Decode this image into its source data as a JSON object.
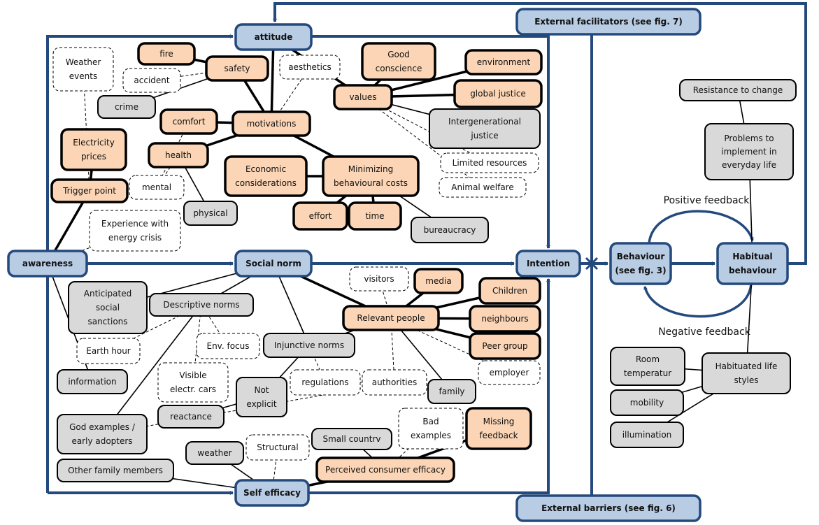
{
  "colors": {
    "blue_fill": "#b8cce4",
    "blue_stroke": "#24497d",
    "orange_fill": "#fbd5b5",
    "grey_fill": "#d9d9d9",
    "dashed_fill": "#ffffff",
    "line": "#000000"
  },
  "feedback": {
    "positive": "Positive feedback",
    "negative": "Negative feedback"
  },
  "nodes": [
    {
      "id": "attitude",
      "type": "blue",
      "lines": [
        "attitude"
      ]
    },
    {
      "id": "social_norm",
      "type": "blue",
      "lines": [
        "Social norm"
      ]
    },
    {
      "id": "awareness",
      "type": "blue",
      "lines": [
        "awareness"
      ]
    },
    {
      "id": "self_efficacy",
      "type": "blue",
      "lines": [
        "Self efficacy"
      ]
    },
    {
      "id": "intention",
      "type": "blue",
      "lines": [
        "Intention"
      ]
    },
    {
      "id": "ext_fac",
      "type": "blue",
      "lines": [
        "External facilitators (see fig. 7)"
      ]
    },
    {
      "id": "ext_bar",
      "type": "blue",
      "lines": [
        "External barriers (see fig. 6)"
      ]
    },
    {
      "id": "behaviour",
      "type": "blue",
      "lines": [
        "Behaviour",
        "(see fig. 3)"
      ]
    },
    {
      "id": "habitual",
      "type": "blue",
      "lines": [
        "Habitual",
        "behaviour"
      ]
    },
    {
      "id": "fire",
      "type": "orange",
      "lines": [
        "fire"
      ]
    },
    {
      "id": "safety",
      "type": "orange",
      "lines": [
        "safety"
      ]
    },
    {
      "id": "comfort",
      "type": "orange",
      "lines": [
        "comfort"
      ]
    },
    {
      "id": "motivations",
      "type": "orange",
      "lines": [
        "motivations"
      ]
    },
    {
      "id": "electricity",
      "type": "orange",
      "lines": [
        "Electricity",
        "prices"
      ]
    },
    {
      "id": "trigger",
      "type": "orange",
      "lines": [
        "Trigger point"
      ]
    },
    {
      "id": "health",
      "type": "orange",
      "lines": [
        "health"
      ]
    },
    {
      "id": "economic",
      "type": "orange",
      "lines": [
        "Economic",
        "considerations"
      ]
    },
    {
      "id": "minimizing",
      "type": "orange",
      "lines": [
        "Minimizing",
        "behavioural  costs"
      ]
    },
    {
      "id": "effort",
      "type": "orange",
      "lines": [
        "effort"
      ]
    },
    {
      "id": "time",
      "type": "orange",
      "lines": [
        "time"
      ]
    },
    {
      "id": "good_conscience",
      "type": "orange",
      "lines": [
        "Good",
        "conscience"
      ]
    },
    {
      "id": "values",
      "type": "orange",
      "lines": [
        "values"
      ]
    },
    {
      "id": "environment",
      "type": "orange",
      "lines": [
        "environment"
      ]
    },
    {
      "id": "global_justice",
      "type": "orange",
      "lines": [
        "global justice"
      ]
    },
    {
      "id": "media",
      "type": "orange",
      "lines": [
        "media"
      ]
    },
    {
      "id": "children",
      "type": "orange",
      "lines": [
        "Children"
      ]
    },
    {
      "id": "relevant",
      "type": "orange",
      "lines": [
        "Relevant people"
      ]
    },
    {
      "id": "neighbours",
      "type": "orange",
      "lines": [
        "neighbours"
      ]
    },
    {
      "id": "peer",
      "type": "orange",
      "lines": [
        "Peer group"
      ]
    },
    {
      "id": "perceived",
      "type": "orange",
      "lines": [
        "Perceived  consumer  efficacy"
      ]
    },
    {
      "id": "missing",
      "type": "orange",
      "lines": [
        "Missing",
        "feedback"
      ]
    },
    {
      "id": "crime",
      "type": "grey",
      "lines": [
        "crime"
      ]
    },
    {
      "id": "physical",
      "type": "grey",
      "lines": [
        "physical"
      ]
    },
    {
      "id": "intergen",
      "type": "grey",
      "lines": [
        "Intergenerational",
        "justice"
      ]
    },
    {
      "id": "bureaucracy",
      "type": "grey",
      "lines": [
        "bureaucracy"
      ]
    },
    {
      "id": "resistance",
      "type": "grey",
      "lines": [
        "Resistance to change"
      ]
    },
    {
      "id": "problems",
      "type": "grey",
      "lines": [
        "Problems  to",
        "implement  in",
        "everyday  life"
      ]
    },
    {
      "id": "anticipated",
      "type": "grey",
      "lines": [
        "Anticipated",
        "social",
        "sanctions"
      ]
    },
    {
      "id": "descriptive",
      "type": "grey",
      "lines": [
        "Descriptive  norms"
      ]
    },
    {
      "id": "injunctive",
      "type": "grey",
      "lines": [
        "Injunctive  norms"
      ]
    },
    {
      "id": "information",
      "type": "grey",
      "lines": [
        "information"
      ]
    },
    {
      "id": "not_explicit",
      "type": "grey",
      "lines": [
        "Not",
        "explicit"
      ]
    },
    {
      "id": "reactance",
      "type": "grey",
      "lines": [
        "reactance"
      ]
    },
    {
      "id": "god_examples",
      "type": "grey",
      "lines": [
        "God examples  /",
        "early adopters"
      ]
    },
    {
      "id": "other_family",
      "type": "grey",
      "lines": [
        "Other family  members"
      ]
    },
    {
      "id": "weather",
      "type": "grey",
      "lines": [
        "weather"
      ]
    },
    {
      "id": "small_country",
      "type": "grey",
      "lines": [
        "Small  countrv"
      ]
    },
    {
      "id": "family",
      "type": "grey",
      "lines": [
        "family"
      ]
    },
    {
      "id": "habituated",
      "type": "grey",
      "lines": [
        "Habituated  life",
        "styles"
      ]
    },
    {
      "id": "room",
      "type": "grey",
      "lines": [
        "Room",
        "temperatur"
      ]
    },
    {
      "id": "mobility",
      "type": "grey",
      "lines": [
        "mobility"
      ]
    },
    {
      "id": "illumination",
      "type": "grey",
      "lines": [
        "illumination"
      ]
    },
    {
      "id": "weather_events",
      "type": "dashed",
      "lines": [
        "Weather",
        "events"
      ]
    },
    {
      "id": "accident",
      "type": "dashed",
      "lines": [
        "accident"
      ]
    },
    {
      "id": "aesthetics",
      "type": "dashed",
      "lines": [
        "aesthetics"
      ]
    },
    {
      "id": "mental",
      "type": "dashed",
      "lines": [
        "mental"
      ]
    },
    {
      "id": "experience",
      "type": "dashed",
      "lines": [
        "Experience  with",
        "energy crisis"
      ]
    },
    {
      "id": "limited",
      "type": "dashed",
      "lines": [
        "Limited  resources"
      ]
    },
    {
      "id": "animal",
      "type": "dashed",
      "lines": [
        "Animal  welfare"
      ]
    },
    {
      "id": "visitors",
      "type": "dashed",
      "lines": [
        "visitors"
      ]
    },
    {
      "id": "earth_hour",
      "type": "dashed",
      "lines": [
        "Earth hour"
      ]
    },
    {
      "id": "env_focus",
      "type": "dashed",
      "lines": [
        "Env.  focus"
      ]
    },
    {
      "id": "visible",
      "type": "dashed",
      "lines": [
        "Visible",
        "electr. cars"
      ]
    },
    {
      "id": "regulations",
      "type": "dashed",
      "lines": [
        "regulations"
      ]
    },
    {
      "id": "authorities",
      "type": "dashed",
      "lines": [
        "authorities"
      ]
    },
    {
      "id": "employer",
      "type": "dashed",
      "lines": [
        "employer"
      ]
    },
    {
      "id": "structural",
      "type": "dashed",
      "lines": [
        "Structural"
      ]
    },
    {
      "id": "bad_examples",
      "type": "dashed",
      "lines": [
        "Bad",
        "examples"
      ]
    }
  ],
  "edges": [
    [
      "attitude",
      "motivations",
      "thick"
    ],
    [
      "attitude",
      "values",
      "thick"
    ],
    [
      "fire",
      "safety",
      "thick"
    ],
    [
      "safety",
      "motivations",
      "thick"
    ],
    [
      "comfort",
      "motivations",
      "thick"
    ],
    [
      "health",
      "motivations",
      "thick"
    ],
    [
      "motivations",
      "minimizing",
      "thick"
    ],
    [
      "economic",
      "minimizing",
      "thick"
    ],
    [
      "minimizing",
      "effort",
      "thick"
    ],
    [
      "minimizing",
      "time",
      "thick"
    ],
    [
      "electricity",
      "trigger",
      "thick"
    ],
    [
      "trigger",
      "awareness",
      "thick"
    ],
    [
      "values",
      "good_conscience",
      "thick"
    ],
    [
      "values",
      "environment",
      "thick"
    ],
    [
      "values",
      "global_justice",
      "thick"
    ],
    [
      "social_norm",
      "relevant",
      "thick"
    ],
    [
      "relevant",
      "media",
      "thick"
    ],
    [
      "relevant",
      "children",
      "thick"
    ],
    [
      "relevant",
      "neighbours",
      "thick"
    ],
    [
      "relevant",
      "peer",
      "thick"
    ],
    [
      "perceived",
      "missing",
      "thick"
    ],
    [
      "perceived",
      "self_efficacy",
      "thick"
    ],
    [
      "safety",
      "crime",
      "thin"
    ],
    [
      "health",
      "physical",
      "thin"
    ],
    [
      "values",
      "intergen",
      "thin"
    ],
    [
      "minimizing",
      "bureaucracy",
      "thin"
    ],
    [
      "social_norm",
      "anticipated",
      "thin"
    ],
    [
      "social_norm",
      "descriptive",
      "thin"
    ],
    [
      "social_norm",
      "injunctive",
      "thin"
    ],
    [
      "injunctive",
      "relevant",
      "thin"
    ],
    [
      "injunctive",
      "not_explicit",
      "thin"
    ],
    [
      "not_explicit",
      "reactance",
      "thin"
    ],
    [
      "descriptive",
      "god_examples",
      "thin"
    ],
    [
      "awareness",
      "information",
      "thin"
    ],
    [
      "relevant",
      "family",
      "thin"
    ],
    [
      "other_family",
      "self_efficacy",
      "thin"
    ],
    [
      "weather",
      "self_efficacy",
      "thin"
    ],
    [
      "small_country",
      "perceived",
      "thin"
    ],
    [
      "resistance",
      "problems",
      "thin"
    ],
    [
      "problems",
      "habitual",
      "thin"
    ],
    [
      "habitual",
      "habituated",
      "thin"
    ],
    [
      "habituated",
      "room",
      "thin"
    ],
    [
      "habituated",
      "mobility",
      "thin"
    ],
    [
      "habituated",
      "illumination",
      "thin"
    ],
    [
      "weather_events",
      "trigger",
      "dashed"
    ],
    [
      "accident",
      "safety",
      "dashed"
    ],
    [
      "aesthetics",
      "motivations",
      "dashed"
    ],
    [
      "comfort",
      "mental",
      "dashed"
    ],
    [
      "health",
      "mental",
      "dashed"
    ],
    [
      "experience",
      "awareness",
      "dashed"
    ],
    [
      "values",
      "limited",
      "dashed"
    ],
    [
      "values",
      "animal",
      "dashed"
    ],
    [
      "descriptive",
      "earth_hour",
      "dashed"
    ],
    [
      "descriptive",
      "env_focus",
      "dashed"
    ],
    [
      "descriptive",
      "visible",
      "dashed"
    ],
    [
      "relevant",
      "visitors",
      "dashed"
    ],
    [
      "relevant",
      "authorities",
      "dashed"
    ],
    [
      "relevant",
      "employer",
      "dashed"
    ],
    [
      "injunctive",
      "regulations",
      "dashed"
    ],
    [
      "regulations",
      "authorities",
      "dashed"
    ],
    [
      "authorities",
      "god_examples",
      "dashed"
    ],
    [
      "structural",
      "self_efficacy",
      "dashed"
    ],
    [
      "bad_examples",
      "perceived",
      "dashed"
    ]
  ]
}
